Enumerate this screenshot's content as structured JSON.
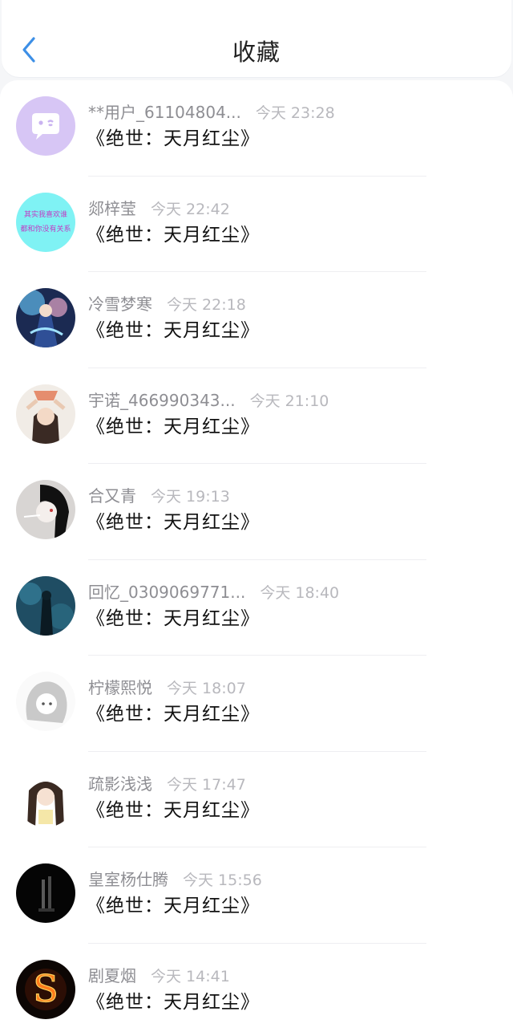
{
  "header": {
    "title": "收藏"
  },
  "icons": {
    "back": "chevron-left-icon"
  },
  "colors": {
    "accent": "#3d8fe6",
    "name_text": "#8e8e93",
    "time_text": "#b8b8bd"
  },
  "items": [
    {
      "name": "**用户_61104804...",
      "time": "今天 23:28",
      "book": "《绝世：天月红尘》"
    },
    {
      "name": "郯梓莹",
      "time": "今天 22:42",
      "book": "《绝世：天月红尘》",
      "avatar_text_1": "其实我喜欢谁",
      "avatar_text_2": "都和你没有关系"
    },
    {
      "name": "冷雪梦寒",
      "time": "今天 22:18",
      "book": "《绝世：天月红尘》"
    },
    {
      "name": "宇诺_466990343...",
      "time": "今天 21:10",
      "book": "《绝世：天月红尘》"
    },
    {
      "name": "合又青",
      "time": "今天 19:13",
      "book": "《绝世：天月红尘》"
    },
    {
      "name": "回忆_0309069771...",
      "time": "今天 18:40",
      "book": "《绝世：天月红尘》"
    },
    {
      "name": "柠檬熙悦",
      "time": "今天 18:07",
      "book": "《绝世：天月红尘》"
    },
    {
      "name": "疏影浅浅",
      "time": "今天 17:47",
      "book": "《绝世：天月红尘》"
    },
    {
      "name": "皇室杨仕腾",
      "time": "今天 15:56",
      "book": "《绝世：天月红尘》"
    },
    {
      "name": "剧夏烟",
      "time": "今天 14:41",
      "book": "《绝世：天月红尘》",
      "avatar_letter": "S"
    }
  ]
}
